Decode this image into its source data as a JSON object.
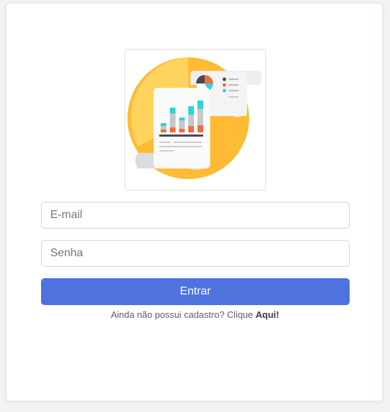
{
  "login": {
    "logo_icon": "financial-report-illustration-icon",
    "email_placeholder": "E-mail",
    "password_placeholder": "Senha",
    "submit_label": "Entrar",
    "signup_prompt": "Ainda não possui cadastro? Clique",
    "signup_link": "Aqui!"
  },
  "colors": {
    "primary": "#4e73df",
    "illustration_circle": "#ffbb33",
    "chart_teal": "#2ed3d6",
    "chart_orange": "#f26b3a"
  }
}
